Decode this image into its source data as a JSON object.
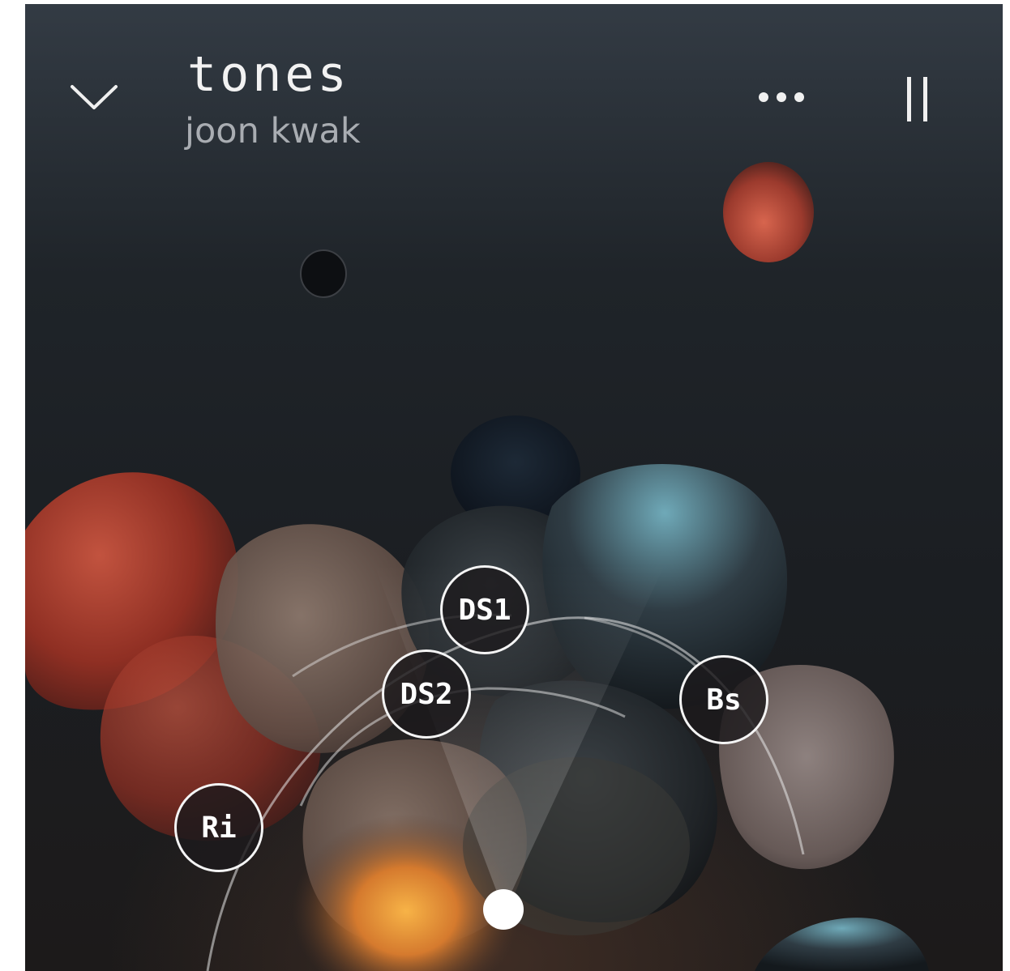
{
  "track": {
    "title": "tones",
    "artist": "joon kwak"
  },
  "header": {
    "collapse_icon": "chevron-down-icon",
    "more_icon": "more-horizontal-icon",
    "pause_icon": "pause-icon"
  },
  "stems": [
    {
      "id": "ds1",
      "label": "DS1"
    },
    {
      "id": "ds2",
      "label": "DS2"
    },
    {
      "id": "bs",
      "label": "Bs"
    },
    {
      "id": "ri",
      "label": "Ri"
    }
  ],
  "colors": {
    "background_top": "#333b44",
    "background_bottom": "#1c1a1a",
    "red_blob": "#a8382a",
    "orange_glow": "#f2a23c",
    "teal_highlight": "#7fb7c4",
    "node_border": "#f4f4f4"
  }
}
